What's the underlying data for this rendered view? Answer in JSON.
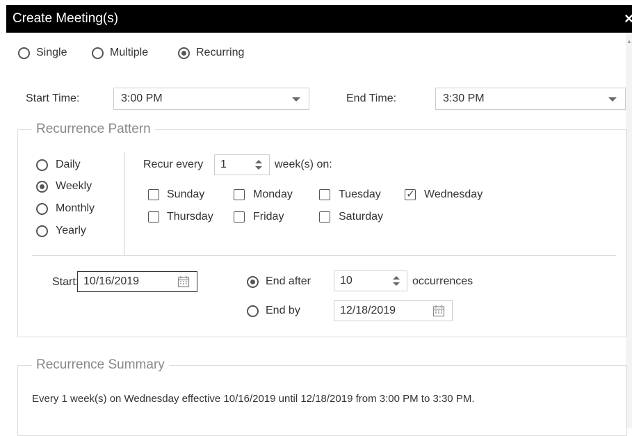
{
  "dialog": {
    "title": "Create Meeting(s)",
    "close_glyph": "×"
  },
  "mode": {
    "options": [
      {
        "label": "Single",
        "selected": false
      },
      {
        "label": "Multiple",
        "selected": false
      },
      {
        "label": "Recurring",
        "selected": true
      }
    ]
  },
  "time": {
    "start_label": "Start Time:",
    "start_value": "3:00 PM",
    "end_label": "End Time:",
    "end_value": "3:30 PM"
  },
  "pattern": {
    "legend": "Recurrence Pattern",
    "frequencies": [
      {
        "label": "Daily",
        "selected": false
      },
      {
        "label": "Weekly",
        "selected": true
      },
      {
        "label": "Monthly",
        "selected": false
      },
      {
        "label": "Yearly",
        "selected": false
      }
    ],
    "recur_every_label": "Recur every",
    "recur_every_value": "1",
    "weeks_on_label": "week(s) on:",
    "days": [
      {
        "label": "Sunday",
        "checked": false
      },
      {
        "label": "Monday",
        "checked": false
      },
      {
        "label": "Tuesday",
        "checked": false
      },
      {
        "label": "Wednesday",
        "checked": true
      },
      {
        "label": "Thursday",
        "checked": false
      },
      {
        "label": "Friday",
        "checked": false
      },
      {
        "label": "Saturday",
        "checked": false
      }
    ]
  },
  "range": {
    "start_label": "Start:",
    "start_value": "10/16/2019",
    "end_after_label": "End after",
    "end_after_selected": true,
    "occurrences_value": "10",
    "occurrences_label": "occurrences",
    "end_by_label": "End by",
    "end_by_selected": false,
    "end_by_value": "12/18/2019"
  },
  "summary": {
    "legend": "Recurrence Summary",
    "text": "Every 1 week(s) on Wednesday effective 10/16/2019 until 12/18/2019 from 3:00 PM to 3:30 PM."
  }
}
